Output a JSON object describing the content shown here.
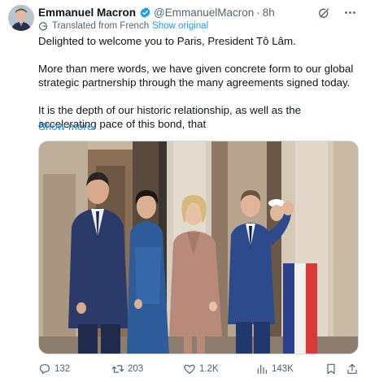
{
  "author": {
    "name": "Emmanuel Macron",
    "handle": "@EmmanuelMacron",
    "separator": "·",
    "time": "8h"
  },
  "translation": {
    "label": "Translated from French",
    "show_original": "Show original"
  },
  "tweet": {
    "paragraphs": [
      "Delighted to welcome you to Paris, President Tô Lâm.",
      "More than mere words, we have given concrete form to our global strategic partnership through the many agreements signed today.",
      "It is the depth of our historic relationship, as well as the accelerating pace of this bond, that"
    ],
    "show_more": "Show more"
  },
  "media": {
    "icon": "photo"
  },
  "actions": {
    "replies": "132",
    "reposts": "203",
    "likes": "1.2K",
    "views": "143K"
  },
  "colors": {
    "link": "#1d9bf0",
    "muted": "#536471",
    "verified": "#1d9bf0",
    "text": "#0f1419"
  },
  "icons": [
    "verified-badge-icon",
    "grok-icon",
    "more-icon",
    "translate-icon",
    "reply-icon",
    "repost-icon",
    "like-icon",
    "views-icon",
    "bookmark-icon",
    "share-icon"
  ]
}
